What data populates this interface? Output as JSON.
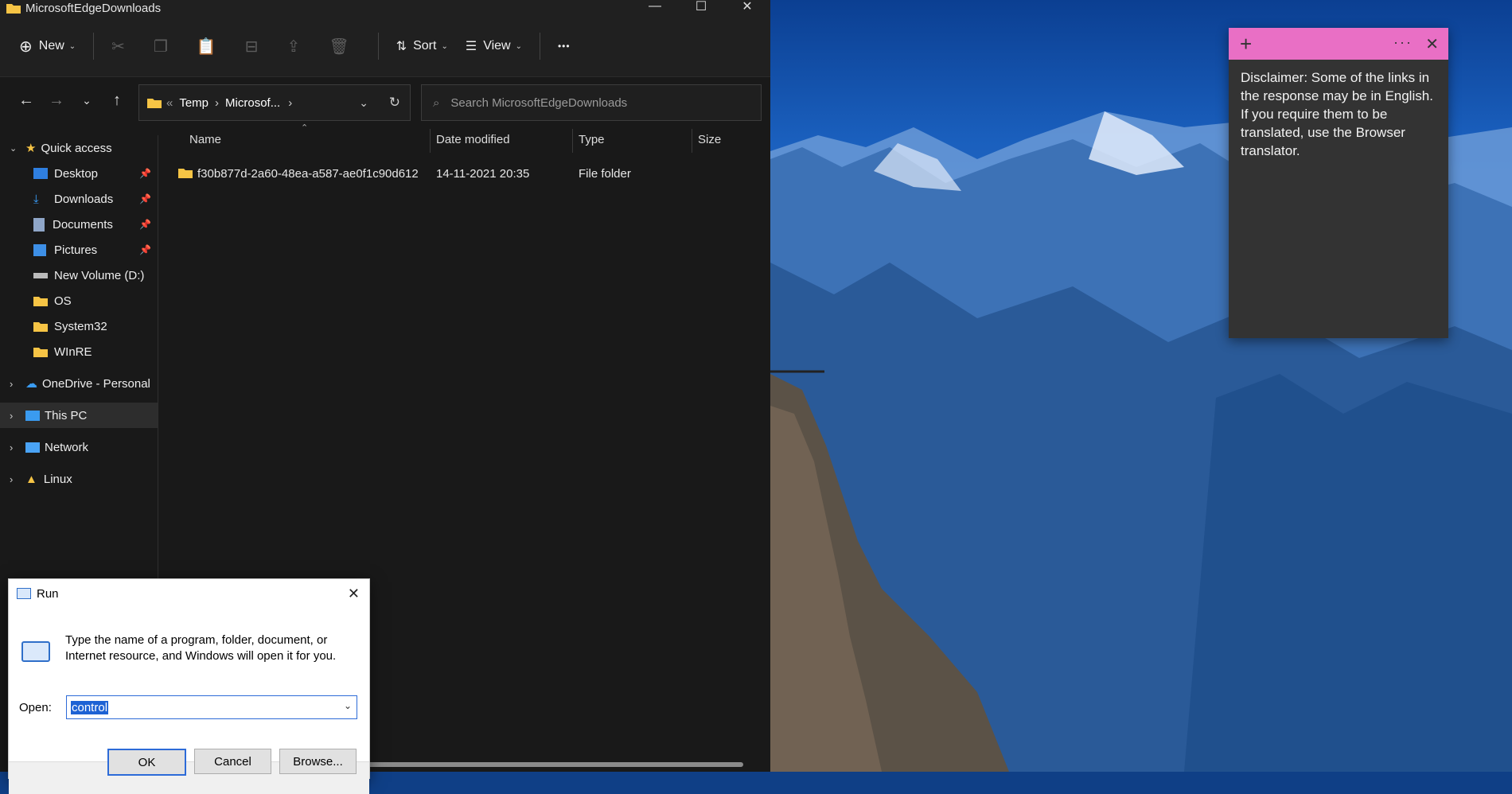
{
  "explorer": {
    "title": "MicrosoftEdgeDownloads",
    "toolbar": {
      "new_label": "New",
      "sort_label": "Sort",
      "view_label": "View",
      "more_label": "•••"
    },
    "address": {
      "crumb_root": "«",
      "crumb1": "Temp",
      "crumb2": "Microsof...",
      "crumb_arrow": "›"
    },
    "search": {
      "placeholder": "Search MicrosoftEdgeDownloads"
    },
    "sidebar": {
      "quick_access": "Quick access",
      "items": [
        {
          "label": "Desktop",
          "pinned": true
        },
        {
          "label": "Downloads",
          "pinned": true
        },
        {
          "label": "Documents",
          "pinned": true
        },
        {
          "label": "Pictures",
          "pinned": true
        },
        {
          "label": "New Volume (D:)"
        },
        {
          "label": "OS"
        },
        {
          "label": "System32"
        },
        {
          "label": "WInRE"
        }
      ],
      "onedrive": "OneDrive - Personal",
      "this_pc": "This PC",
      "network": "Network",
      "linux": "Linux"
    },
    "columns": {
      "name": "Name",
      "date": "Date modified",
      "type": "Type",
      "size": "Size"
    },
    "files": [
      {
        "name": "f30b877d-2a60-48ea-a587-ae0f1c90d612",
        "date": "14-11-2021 20:35",
        "type": "File folder",
        "size": ""
      }
    ]
  },
  "run": {
    "title": "Run",
    "description": "Type the name of a program, folder, document, or Internet resource, and Windows will open it for you.",
    "open_label": "Open:",
    "open_value": "control",
    "ok": "OK",
    "cancel": "Cancel",
    "browse": "Browse..."
  },
  "sticky": {
    "text": "Disclaimer: Some of the links in the response may be in English. If you require them to be translated, use the Browser translator."
  },
  "colors": {
    "explorer_bg": "#191919",
    "sticky_bar": "#e96fc5",
    "run_selection": "#1d62d4",
    "folder_yellow": "#f6c445"
  }
}
